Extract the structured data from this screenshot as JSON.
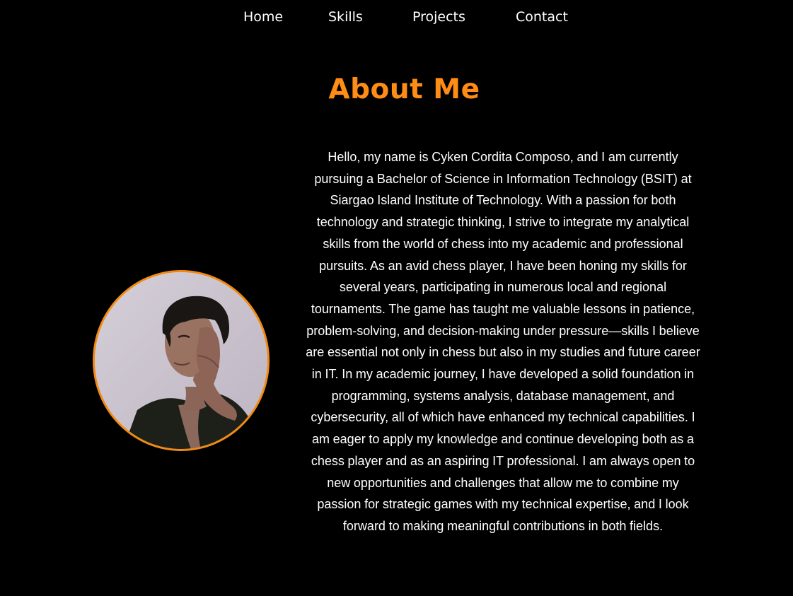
{
  "nav": {
    "items": [
      {
        "label": "Home"
      },
      {
        "label": "Skills"
      },
      {
        "label": "Projects"
      },
      {
        "label": "Contact"
      }
    ]
  },
  "about": {
    "title": "About Me",
    "bio": "Hello, my name is Cyken Cordita Composo, and I am currently pursuing a Bachelor of Science in Information Technology (BSIT) at Siargao Island Institute of Technology. With a passion for both technology and strategic thinking, I strive to integrate my analytical skills from the world of chess into my academic and professional pursuits. As an avid chess player, I have been honing my skills for several years, participating in numerous local and regional tournaments. The game has taught me valuable lessons in patience, problem-solving, and decision-making under pressure—skills I believe are essential not only in chess but also in my studies and future career in IT. In my academic journey, I have developed a solid foundation in programming, systems analysis, database management, and cybersecurity, all of which have enhanced my technical capabilities. I am eager to apply my knowledge and continue developing both as a chess player and as an aspiring IT professional. I am always open to new opportunities and challenges that allow me to combine my passion for strategic games with my technical expertise, and I look forward to making meaningful contributions in both fields."
  },
  "colors": {
    "background": "#000000",
    "accent": "#ff8c14",
    "text": "#ffffff"
  }
}
